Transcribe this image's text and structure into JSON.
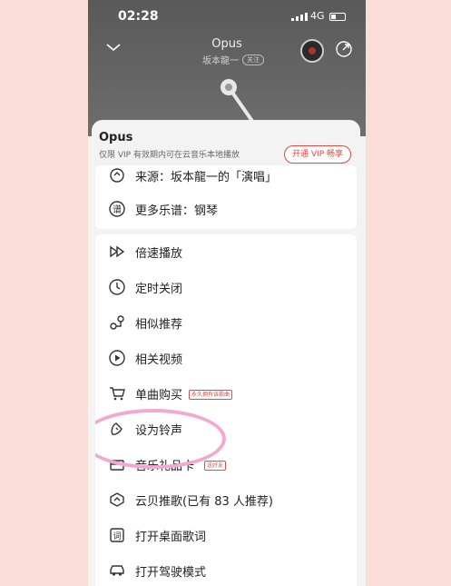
{
  "status": {
    "time": "02:28",
    "network": "4G"
  },
  "player": {
    "song_title": "Opus",
    "artist": "坂本龍一",
    "follow_label": "关注"
  },
  "sheet": {
    "title": "Opus",
    "subtitle": "仅限 VIP 有效期内可在云音乐本地播放",
    "vip_button": "开通 VIP 畅享"
  },
  "top_items": [
    {
      "icon": "source-icon",
      "label": "来源：坂本龍一的「演唱」"
    },
    {
      "icon": "sheet-music-icon",
      "label": "更多乐谱：钢琴"
    }
  ],
  "menu_items": [
    {
      "icon": "playback-speed-icon",
      "label": "倍速播放"
    },
    {
      "icon": "timer-icon",
      "label": "定时关闭"
    },
    {
      "icon": "similar-icon",
      "label": "相似推荐"
    },
    {
      "icon": "video-icon",
      "label": "相关视频"
    },
    {
      "icon": "cart-icon",
      "label": "单曲购买",
      "tag": "永久拥有该歌曲"
    },
    {
      "icon": "ringtone-icon",
      "label": "设为铃声"
    },
    {
      "icon": "music-gift-icon",
      "label": "音乐礼品卡",
      "tag": "送好友"
    },
    {
      "icon": "cloud-shell-icon",
      "label": "云贝推歌(已有 83 人推荐)"
    },
    {
      "icon": "desktop-lyrics-icon",
      "label": "打开桌面歌词"
    },
    {
      "icon": "car-icon",
      "label": "打开驾驶模式"
    }
  ],
  "colors": {
    "accent": "#e04a3f",
    "page_bg": "#f9ddd6",
    "player_bg": "#5e5e5e",
    "highlight_circle": "#f1a9d2"
  }
}
